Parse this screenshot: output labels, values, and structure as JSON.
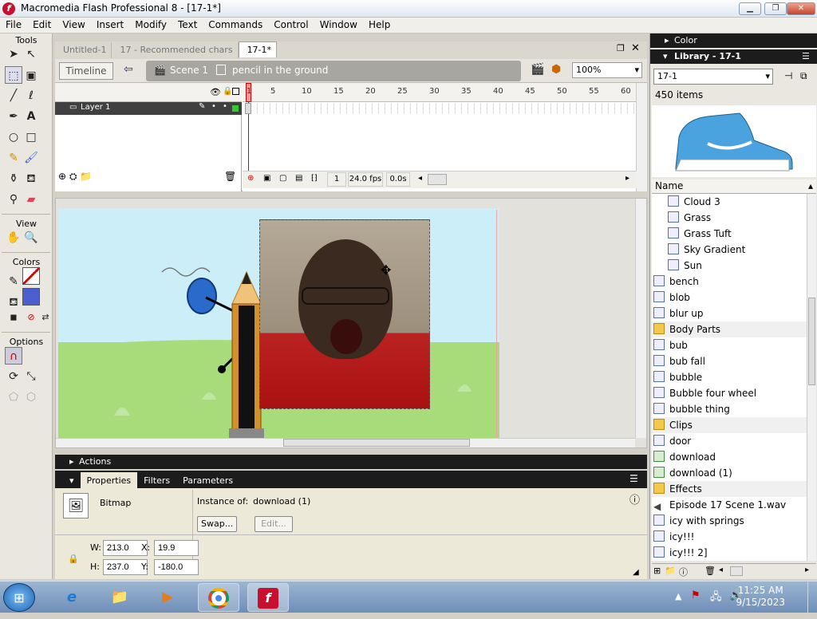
{
  "window": {
    "title": "Macromedia Flash Professional 8 - [17-1*]"
  },
  "menu": [
    "File",
    "Edit",
    "View",
    "Insert",
    "Modify",
    "Text",
    "Commands",
    "Control",
    "Window",
    "Help"
  ],
  "tools": {
    "header": "Tools",
    "view_header": "View",
    "colors_header": "Colors",
    "options_header": "Options"
  },
  "doc_tabs": [
    "Untitled-1",
    "17 - Recommended chars",
    "17-1*"
  ],
  "edit_bar": {
    "timeline_label": "Timeline",
    "scene": "Scene 1",
    "symbol": "pencil in the ground",
    "zoom": "100%"
  },
  "timeline": {
    "layer": "Layer 1",
    "ruler": [
      "1",
      "5",
      "10",
      "15",
      "20",
      "25",
      "30",
      "35",
      "40",
      "45",
      "50",
      "55",
      "60"
    ],
    "current_frame": "1",
    "fps": "24.0 fps",
    "time": "0.0s"
  },
  "actions": {
    "label": "Actions"
  },
  "properties": {
    "tabs": [
      "Properties",
      "Filters",
      "Parameters"
    ],
    "type": "Bitmap",
    "instance_label": "Instance of:",
    "instance_value": "download (1)",
    "swap": "Swap...",
    "edit": "Edit...",
    "w_label": "W:",
    "w": "213.0",
    "h_label": "H:",
    "h": "237.0",
    "x_label": "X:",
    "x": "19.9",
    "y_label": "Y:",
    "y": "-180.0"
  },
  "right_panel": {
    "color_header": "Color",
    "library_header": "Library - 17-1",
    "library_select": "17-1",
    "item_count": "450 items",
    "name_header": "Name",
    "items": [
      {
        "name": "Cloud 3",
        "type": "graphic",
        "indent": true
      },
      {
        "name": "Grass",
        "type": "graphic",
        "indent": true
      },
      {
        "name": "Grass Tuft",
        "type": "graphic",
        "indent": true
      },
      {
        "name": "Sky Gradient",
        "type": "graphic",
        "indent": true
      },
      {
        "name": "Sun",
        "type": "graphic",
        "indent": true
      },
      {
        "name": "bench",
        "type": "graphic",
        "indent": false
      },
      {
        "name": "blob",
        "type": "graphic",
        "indent": false
      },
      {
        "name": "blur up",
        "type": "mc",
        "indent": false
      },
      {
        "name": "Body Parts",
        "type": "folder",
        "indent": false
      },
      {
        "name": "bub",
        "type": "graphic",
        "indent": false
      },
      {
        "name": "bub fall",
        "type": "mc",
        "indent": false
      },
      {
        "name": "bubble",
        "type": "graphic",
        "indent": false
      },
      {
        "name": "Bubble four wheel",
        "type": "graphic",
        "indent": false
      },
      {
        "name": "bubble thing",
        "type": "graphic",
        "indent": false
      },
      {
        "name": "Clips",
        "type": "folder",
        "indent": false
      },
      {
        "name": "door",
        "type": "graphic",
        "indent": false
      },
      {
        "name": "download",
        "type": "bitmap",
        "indent": false
      },
      {
        "name": "download (1)",
        "type": "bitmap",
        "indent": false
      },
      {
        "name": "Effects",
        "type": "folder",
        "indent": false
      },
      {
        "name": "Episode 17 Scene 1.wav",
        "type": "sound",
        "indent": false
      },
      {
        "name": "icy with springs",
        "type": "graphic",
        "indent": false
      },
      {
        "name": "icy!!!",
        "type": "graphic",
        "indent": false
      },
      {
        "name": "icy!!! 2]",
        "type": "graphic",
        "indent": false
      }
    ]
  },
  "taskbar": {
    "time": "11:25 AM",
    "date": "9/15/2023"
  },
  "colors": {
    "brand": "#c8102e",
    "panel_dark": "#1c1c1c",
    "sky": "#cbeef9",
    "grass": "#a8dc7a"
  }
}
